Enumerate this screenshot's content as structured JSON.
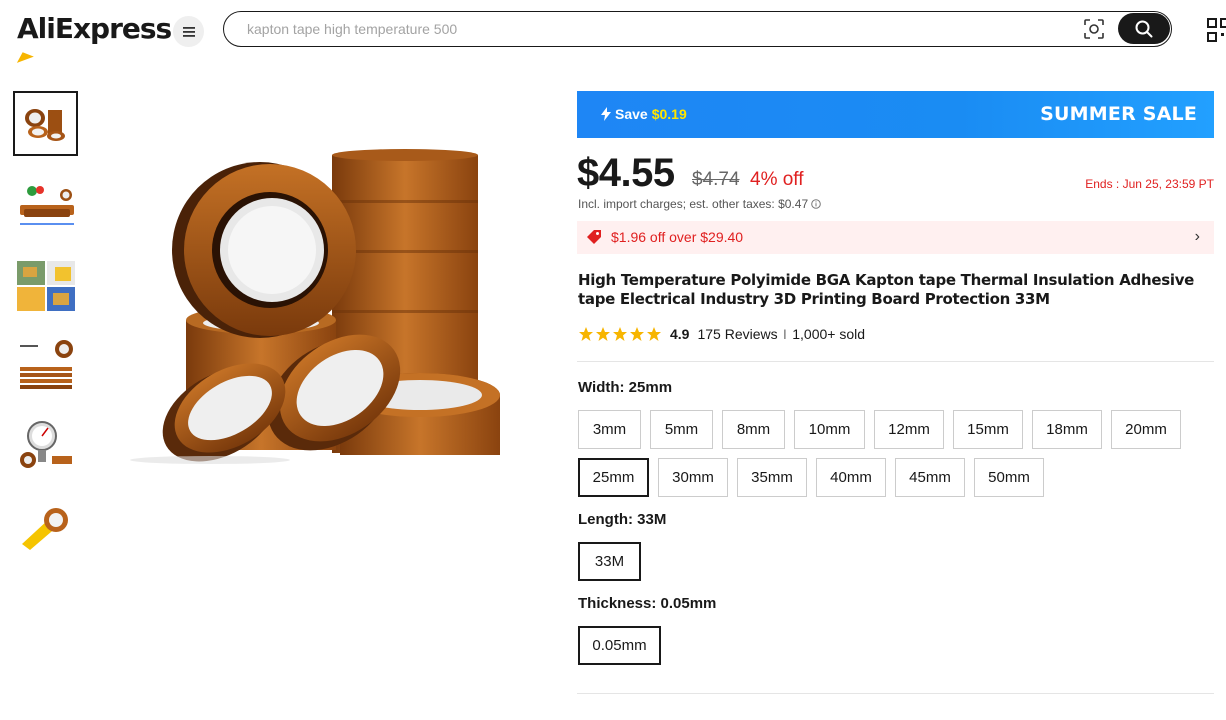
{
  "header": {
    "logo": "AliExpress",
    "search_placeholder": "kapton tape high temperature 500"
  },
  "promo": {
    "save_label": "Save",
    "save_amount": "$0.19",
    "banner": "SUMMER SALE"
  },
  "price": {
    "current": "$4.55",
    "original": "$4.74",
    "discount": "4% off",
    "ends": "Ends :  Jun 25, 23:59 PT",
    "taxes": "Incl. import charges; est. other taxes: $0.47"
  },
  "coupon": {
    "text": "$1.96 off over $29.40",
    "arrow": "›"
  },
  "product": {
    "title": "High Temperature Polyimide BGA Kapton tape Thermal Insulation Adhesive tape Electrical Industry 3D Printing Board Protection 33M",
    "rating": "4.9",
    "reviews": "175 Reviews",
    "sold": "1,000+ sold"
  },
  "width": {
    "label": "Width: 25mm",
    "options": [
      "3mm",
      "5mm",
      "8mm",
      "10mm",
      "12mm",
      "15mm",
      "18mm",
      "20mm",
      "25mm",
      "30mm",
      "35mm",
      "40mm",
      "45mm",
      "50mm"
    ],
    "selected": "25mm"
  },
  "length": {
    "label": "Length: 33M",
    "options": [
      "33M"
    ]
  },
  "thickness": {
    "label": "Thickness: 0.05mm",
    "options": [
      "0.05mm"
    ]
  },
  "colors": {
    "promo_blue": "#1e86f5",
    "accent_red": "#e02020",
    "star": "#f7b500",
    "tape_amber": "#b8621b"
  }
}
